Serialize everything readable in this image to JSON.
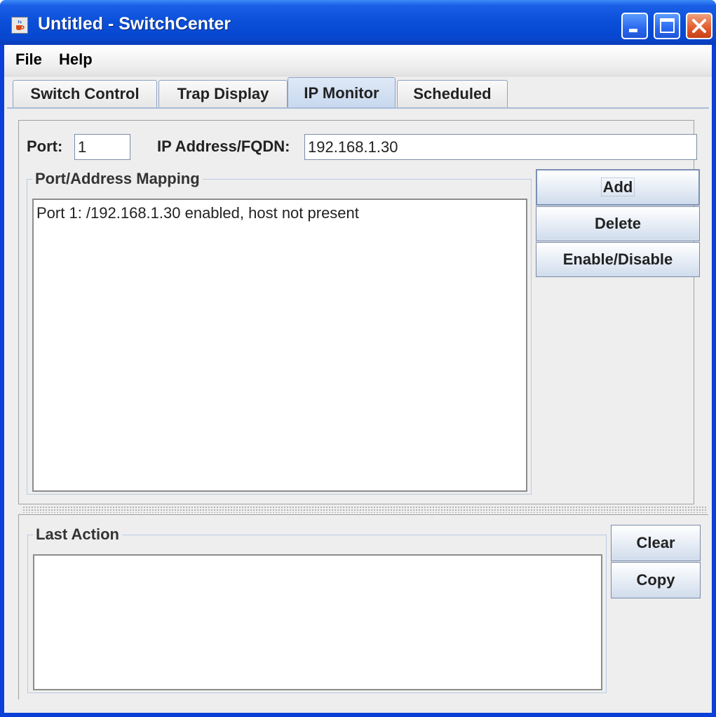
{
  "window": {
    "title": "Untitled - SwitchCenter",
    "app_icon": "java-cup-icon",
    "controls": [
      "minimize-icon",
      "maximize-icon",
      "close-icon"
    ]
  },
  "menubar": {
    "items": [
      {
        "label": "File"
      },
      {
        "label": "Help"
      }
    ]
  },
  "tabs": [
    {
      "label": "Switch Control",
      "active": false
    },
    {
      "label": "Trap Display",
      "active": false
    },
    {
      "label": "IP Monitor",
      "active": true
    },
    {
      "label": "Scheduled",
      "active": false
    }
  ],
  "ip_monitor": {
    "port_label": "Port:",
    "port_value": "1",
    "ip_label": "IP Address/FQDN:",
    "ip_value": "192.168.1.30",
    "mapping_group_title": "Port/Address Mapping",
    "mappings": [
      "Port 1: /192.168.1.30 enabled, host not present"
    ],
    "buttons": {
      "add": "Add",
      "delete": "Delete",
      "enable_disable": "Enable/Disable"
    },
    "last_action_title": "Last Action",
    "last_action_text": "",
    "bottom_buttons": {
      "clear": "Clear",
      "copy": "Copy"
    }
  },
  "colors": {
    "titlebar": "#0a4ed8",
    "tab_active": "#c7d8ee",
    "panel_bg": "#eeeeee",
    "close_button": "#e05a2a"
  }
}
